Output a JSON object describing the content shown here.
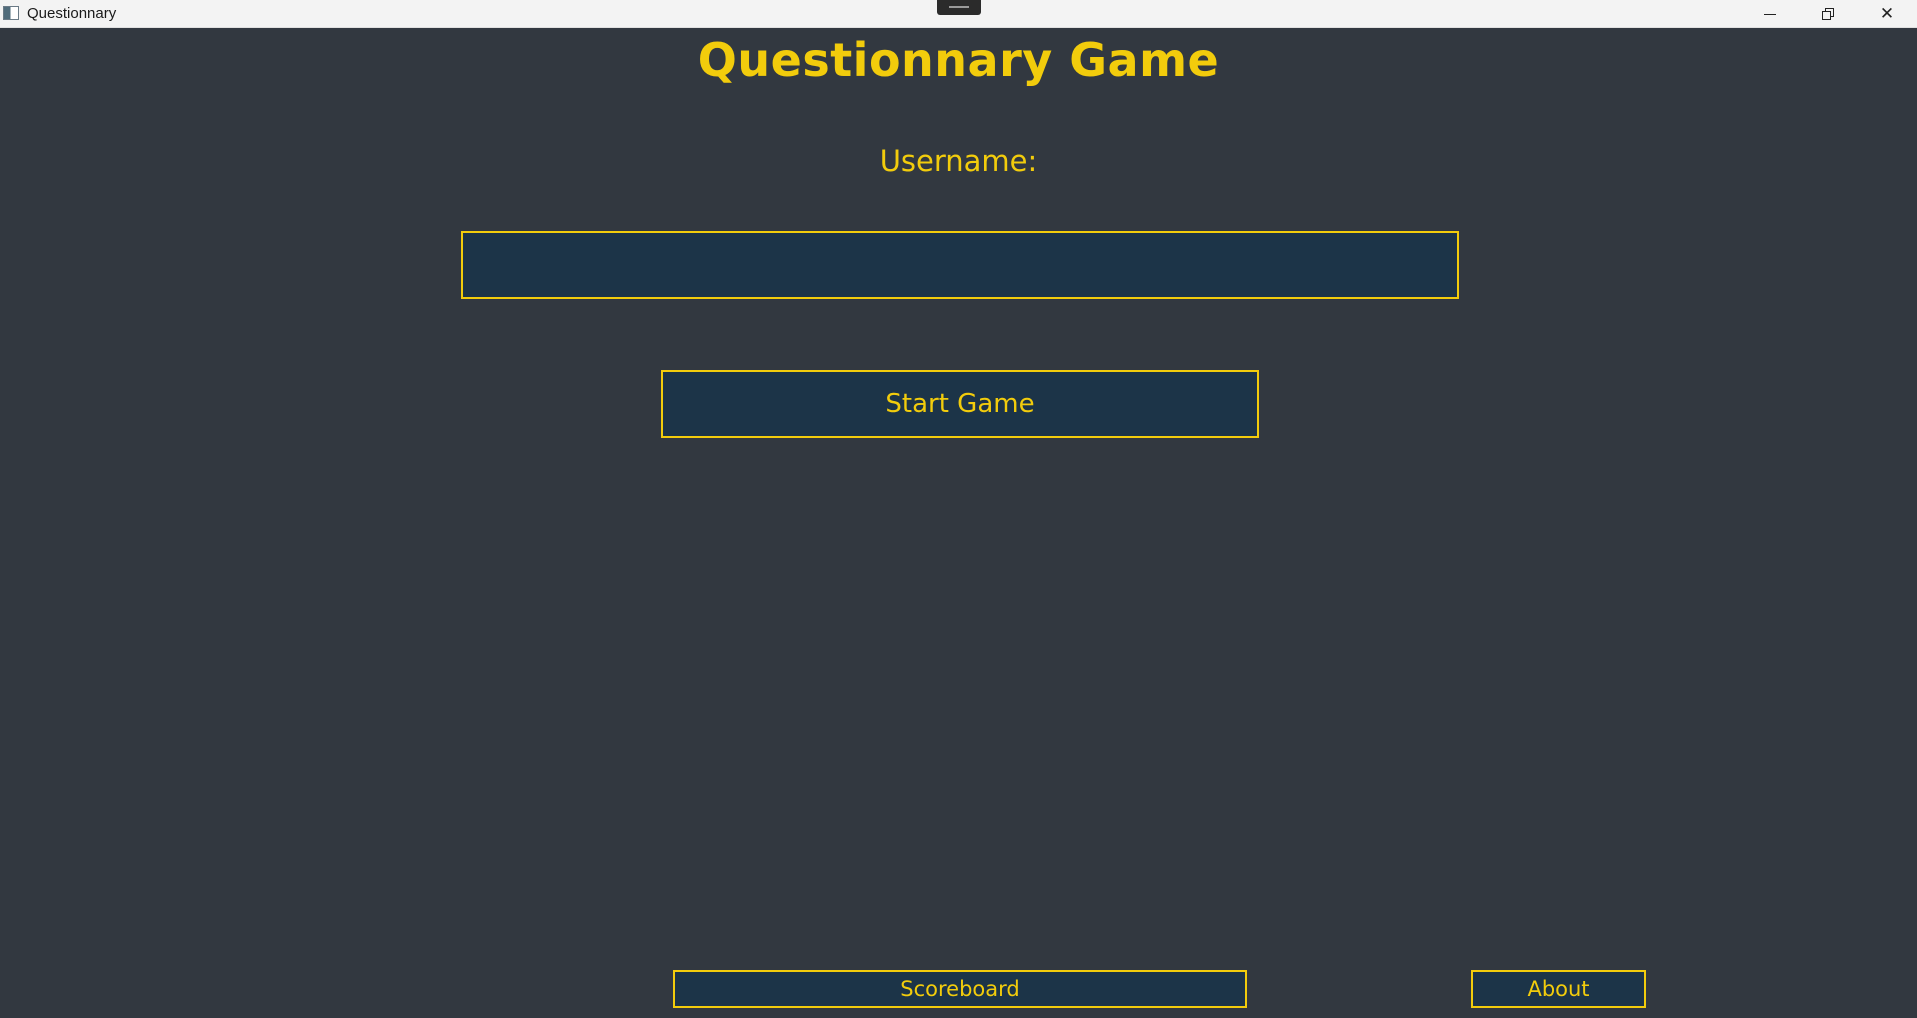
{
  "window": {
    "title": "Questionnary",
    "controls": {
      "minimize_icon": "minimize-icon",
      "restore_icon": "restore-icon",
      "close_glyph": "✕"
    }
  },
  "main": {
    "heading": "Questionnary Game",
    "username_label": "Username:",
    "username_value": "",
    "start_button_label": "Start Game"
  },
  "footer": {
    "scoreboard_label": "Scoreboard",
    "about_label": "About"
  },
  "colors": {
    "background": "#323840",
    "accent": "#f2cc0c",
    "control_fill": "#1c3448",
    "titlebar": "#f3f3f3"
  }
}
